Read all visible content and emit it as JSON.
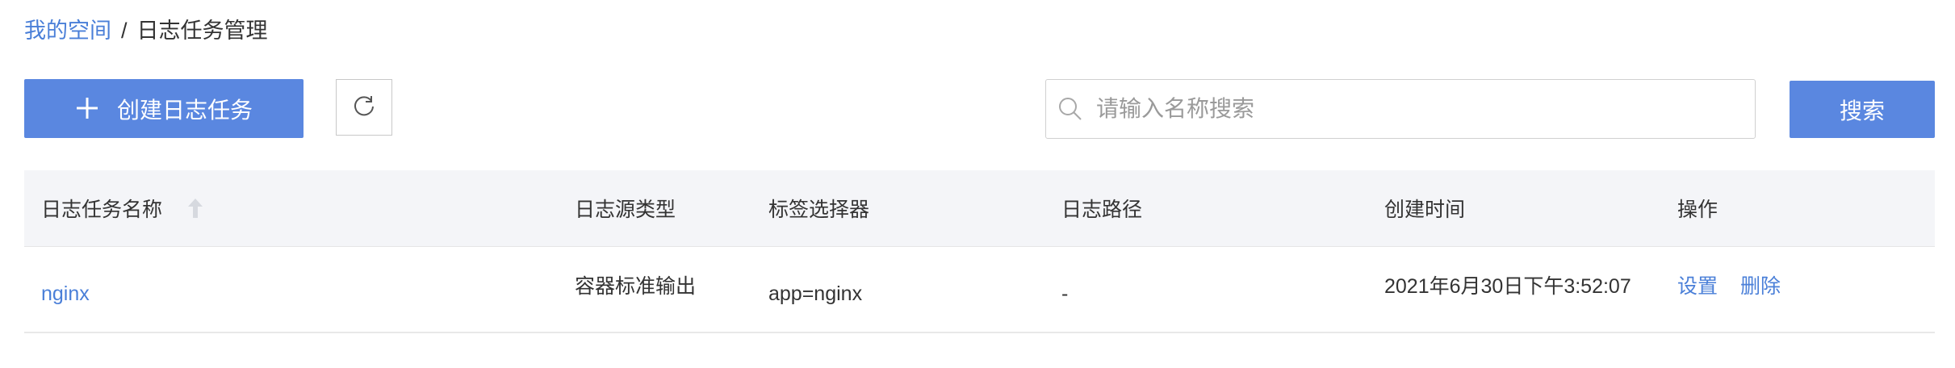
{
  "breadcrumb": {
    "parent": "我的空间",
    "separator": "/",
    "current": "日志任务管理"
  },
  "toolbar": {
    "create_label": "创建日志任务",
    "create_icon": "plus-icon",
    "refresh_icon": "refresh-icon",
    "search_placeholder": "请输入名称搜索",
    "search_value": "",
    "search_icon": "search-icon",
    "search_button": "搜索"
  },
  "table": {
    "columns": [
      "日志任务名称",
      "日志源类型",
      "标签选择器",
      "日志路径",
      "创建时间",
      "操作"
    ],
    "sort_icon": "sort-up-icon",
    "rows": [
      {
        "name": "nginx",
        "source_type": "容器标准输出",
        "selector": "app=nginx",
        "path": "-",
        "created": "2021年6月30日下午3:52:07",
        "actions": [
          "设置",
          "删除"
        ]
      }
    ]
  },
  "colors": {
    "primary": "#5a87e0",
    "link": "#4a7fd8",
    "header_bg": "#f4f5f8"
  }
}
